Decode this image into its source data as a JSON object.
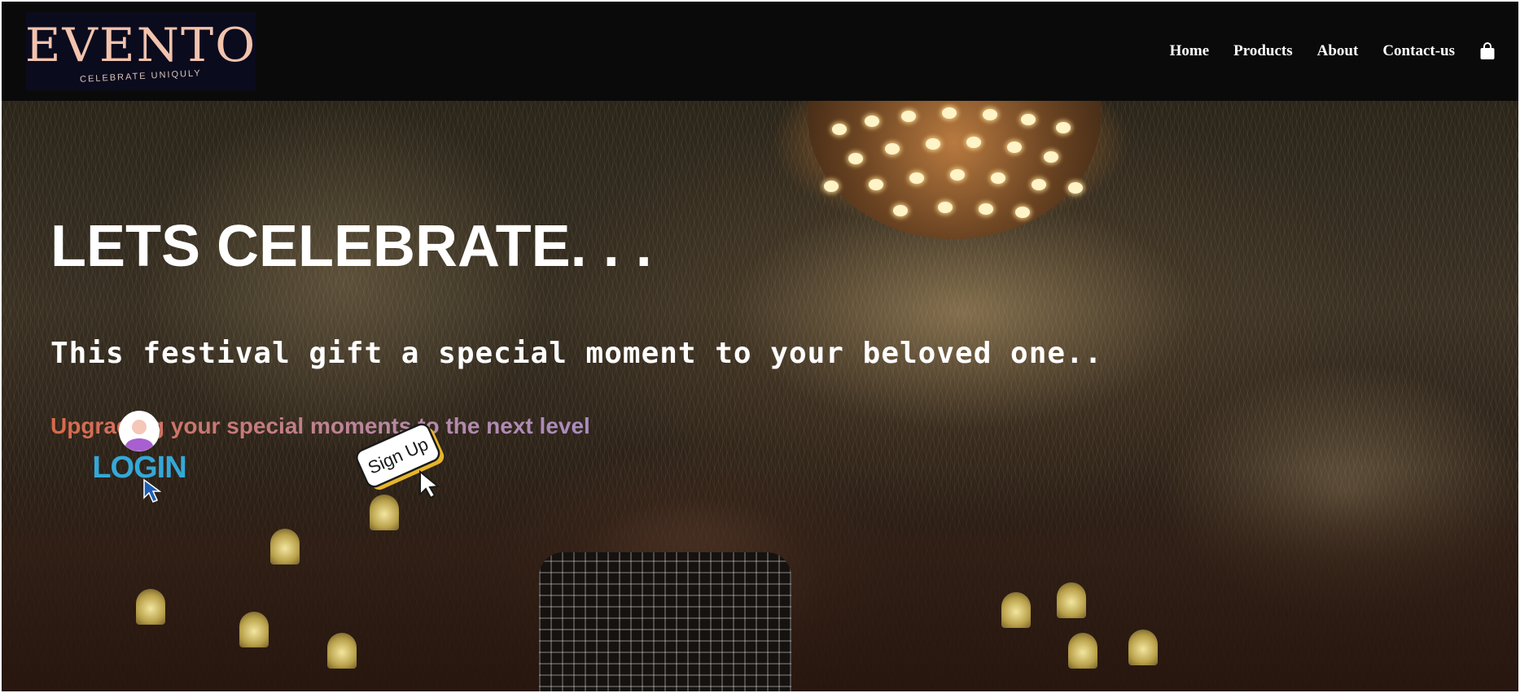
{
  "brand": {
    "name": "EVENTO",
    "tagline": "CELEBRATE UNIQULY",
    "logo_color": "#f2c3ad"
  },
  "nav": {
    "items": [
      {
        "label": "Home"
      },
      {
        "label": "Products"
      },
      {
        "label": "About"
      },
      {
        "label": "Contact-us"
      }
    ],
    "cart_icon": "shopping-bag-icon"
  },
  "hero": {
    "title": "LETS CELEBRATE. . .",
    "subtitle": "This festival gift a special moment to your beloved one..",
    "tagline": "Upgrading your special moments to the next level",
    "login_label": "LOGIN",
    "signup_label": "Sign Up",
    "colors": {
      "login": "#34a8d8",
      "tagline_start": "#d9694a",
      "tagline_end": "#a98cc0"
    }
  }
}
